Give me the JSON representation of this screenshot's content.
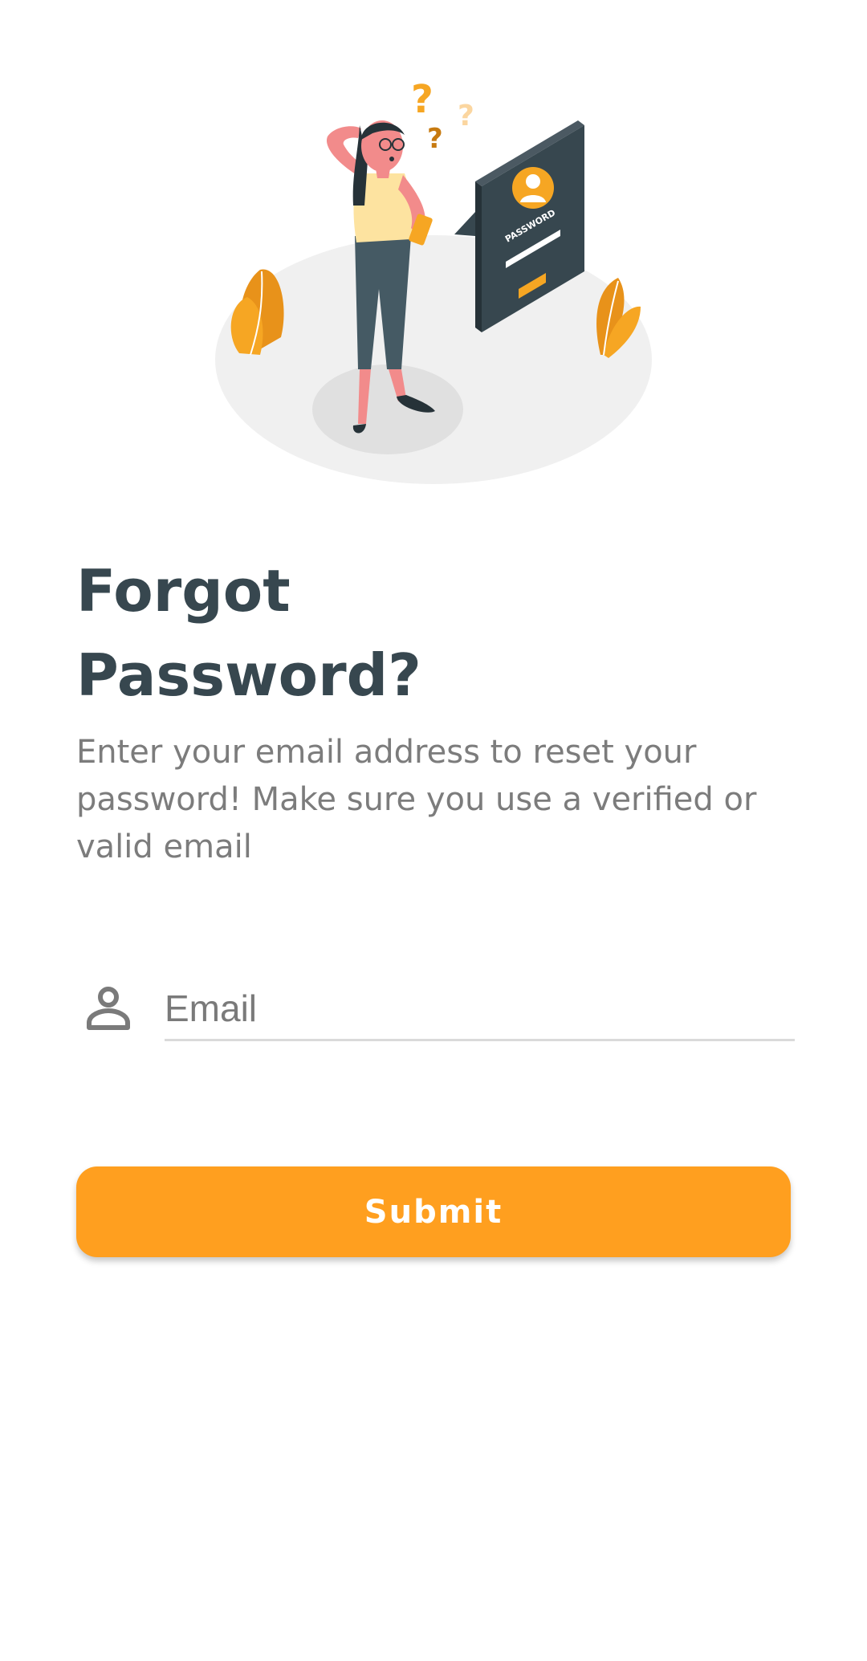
{
  "header": {
    "illustration": "forgot-password-illustration",
    "illustration_badge_text": "PASSWORD"
  },
  "main": {
    "title": "Forgot Password?",
    "description": "Enter your email address to reset your password! Make sure you use a verified or valid email"
  },
  "form": {
    "email": {
      "icon": "user-icon",
      "placeholder": "Email",
      "value": ""
    },
    "submit_label": "Submit"
  },
  "colors": {
    "accent": "#ff9f1f",
    "title": "#37474f",
    "body_text": "#7c7c7c",
    "input_underline": "#dadada"
  }
}
